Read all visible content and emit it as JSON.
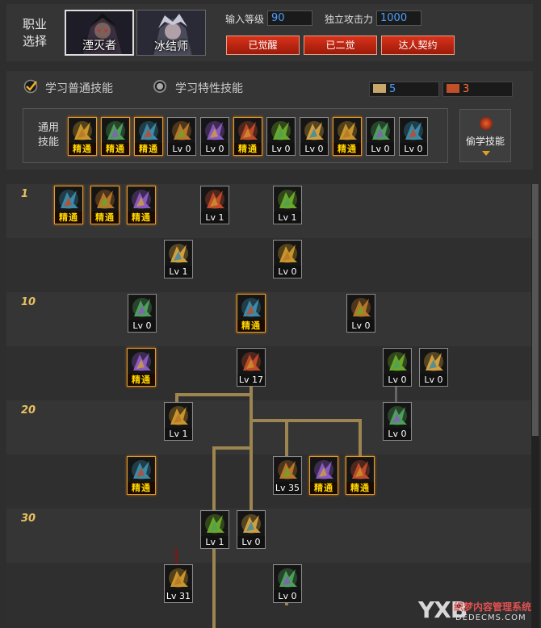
{
  "header": {
    "class_label": "职业选择",
    "classes": [
      {
        "name": "湮灭者",
        "selected": true
      },
      {
        "name": "冰结师",
        "selected": false
      }
    ],
    "input_level_label": "输入等级",
    "input_level_value": "90",
    "independent_attack_label": "独立攻击力",
    "independent_attack_value": "1000",
    "buttons": [
      "已觉醒",
      "已二觉",
      "达人契约"
    ]
  },
  "options": {
    "learn_normal_label": "学习普通技能",
    "learn_special_label": "学习特性技能",
    "normal_selected": true,
    "sp_points": "5",
    "tp_points": "3"
  },
  "common_skills": {
    "label": "通用技能",
    "skills": [
      {
        "icon": "sit-meditate-skill-icon",
        "level": "精通",
        "mastered": true
      },
      {
        "icon": "crawl-skill-icon",
        "level": "精通",
        "mastered": true
      },
      {
        "icon": "dash-kick-skill-icon",
        "level": "精通",
        "mastered": true
      },
      {
        "icon": "wings-skill-icon",
        "level": "Lv 0",
        "mastered": false
      },
      {
        "icon": "crosshair-skill-icon",
        "level": "Lv 0",
        "mastered": false
      },
      {
        "icon": "crosshair-star-skill-icon",
        "level": "精通",
        "mastered": true
      },
      {
        "icon": "figure-strike-skill-icon",
        "level": "Lv 0",
        "mastered": false
      },
      {
        "icon": "figure-gear-skill-icon",
        "level": "Lv 0",
        "mastered": false
      },
      {
        "icon": "eye-ring-skill-icon",
        "level": "精通",
        "mastered": true
      },
      {
        "icon": "golden-warrior-skill-icon",
        "level": "Lv 0",
        "mastered": false
      },
      {
        "icon": "leap-skill-icon",
        "level": "Lv 0",
        "mastered": false
      }
    ],
    "steal_label": "偷学技能"
  },
  "tree": {
    "level_markers": [
      "1",
      "10",
      "20",
      "30"
    ],
    "skills": [
      {
        "icon": "fire-burst-skill-icon",
        "level": "精通",
        "mastered": true
      },
      {
        "icon": "figure-glow-skill-icon",
        "level": "精通",
        "mastered": true
      },
      {
        "icon": "green-explosion-skill-icon",
        "level": "精通",
        "mastered": true
      },
      {
        "icon": "spiral-dash-skill-icon",
        "level": "Lv 1",
        "mastered": false
      },
      {
        "icon": "vortex-skill-icon",
        "level": "Lv 1",
        "mastered": false
      },
      {
        "icon": "slash-skill-icon",
        "level": "Lv 1",
        "mastered": false
      },
      {
        "icon": "orb-swirl-skill-icon",
        "level": "Lv 0",
        "mastered": false
      },
      {
        "icon": "blue-flame-skill-icon",
        "level": "Lv 0",
        "mastered": false
      },
      {
        "icon": "pillar-light-skill-icon",
        "level": "精通",
        "mastered": true
      },
      {
        "icon": "dragon-wave-skill-icon",
        "level": "Lv 0",
        "mastered": false
      },
      {
        "icon": "green-star-skill-icon",
        "level": "精通",
        "mastered": true
      },
      {
        "icon": "red-star-skill-icon",
        "level": "Lv 17",
        "mastered": false
      },
      {
        "icon": "ring-swirl-skill-icon",
        "level": "Lv 0",
        "mastered": false
      },
      {
        "icon": "claw-burst-skill-icon",
        "level": "Lv 0",
        "mastered": false
      },
      {
        "icon": "crown-flame-skill-icon",
        "level": "Lv 1",
        "mastered": false
      },
      {
        "icon": "green-figure-skill-icon",
        "level": "Lv 0",
        "mastered": false
      },
      {
        "icon": "hex-star-skill-icon",
        "level": "精通",
        "mastered": true
      },
      {
        "icon": "fire-wall-skill-icon",
        "level": "Lv 35",
        "mastered": false
      },
      {
        "icon": "green-shard-skill-icon",
        "level": "精通",
        "mastered": true
      },
      {
        "icon": "teal-sphere-skill-icon",
        "level": "精通",
        "mastered": true
      },
      {
        "icon": "meteor-skill-icon",
        "level": "Lv 1",
        "mastered": false
      },
      {
        "icon": "eye-beam-skill-icon",
        "level": "Lv 0",
        "mastered": false
      },
      {
        "icon": "red-diamond-skill-icon",
        "level": "Lv 31",
        "mastered": false
      },
      {
        "icon": "sun-ring-skill-icon",
        "level": "Lv 0",
        "mastered": false
      }
    ]
  },
  "watermark": {
    "logo": "YXB",
    "text": "织梦内容管理系统",
    "url": "DEDECMS.COM"
  },
  "colors": {
    "accent_gold": "#e29a2a",
    "connector": "#9c8550",
    "button_red": "#c8281a",
    "input_blue": "#4aa0ff"
  }
}
